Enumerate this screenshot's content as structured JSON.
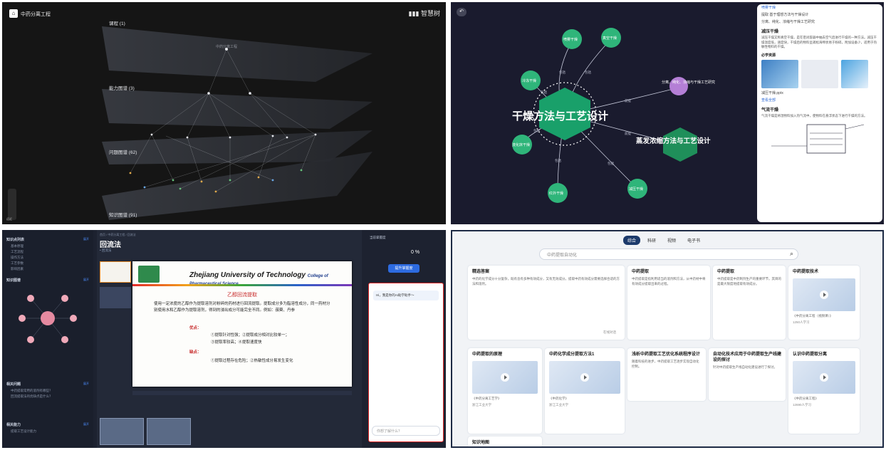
{
  "q1": {
    "title": "中药分离工程",
    "logo": "智慧树",
    "layers": [
      {
        "label": "课程 (1)"
      },
      {
        "label": "能力图谱 (3)"
      },
      {
        "label": "问题图谱 (62)"
      },
      {
        "label": "知识图谱 (91)"
      }
    ],
    "top_node": "中药分离工程",
    "zoom_label": "远近"
  },
  "q2": {
    "center": "干燥方法与工艺设计",
    "second": "蒸发浓缩方法与工艺设计",
    "nodes": [
      "喷雾干燥",
      "冷冻干燥",
      "真空干燥",
      "流化床干燥",
      "红外干燥",
      "减压干燥",
      "微波干燥"
    ],
    "purple_node": "分离、纯化、浓缩与干燥工艺研究",
    "edge_labels": [
      "包括",
      "包括",
      "包括",
      "包括",
      "包括",
      "包括",
      "包括",
      "前提",
      "前提"
    ],
    "side": {
      "top_item": "喷雾干燥",
      "rows": [
        "提取 基于理想方法与干燥设计",
        "分离、纯化、浓缩与干燥工艺研究"
      ],
      "h1": "减压干燥",
      "h1_text": "减压干燥又称真空干燥，是在密闭容器中抽去空气后进行干燥的一种方法。减压干燥温度低，速度快，干燥后的物料呈疏松海绵状易于粉碎，附加设备少，适用于热敏性物料的干燥。",
      "res_title": "必学资源",
      "res_file": "减压干燥.pptx",
      "link": "查看全部",
      "h2": "气流干燥",
      "h2_text": "气流干燥是将湿物料加入热气流中，使物料在悬浮状态下进行干燥的方法。"
    }
  },
  "q3": {
    "left_sections": [
      {
        "title": "知识点列表",
        "more": "展开",
        "items": [
          "基本原理",
          "工艺流程",
          "操作方法",
          "工艺参数",
          "影响因素"
        ]
      },
      {
        "title": "知识图谱",
        "more": "展开"
      },
      {
        "title": "相关问题",
        "more": "展开",
        "items": [
          "中药提取常用的溶剂有哪些？",
          "回流提取法的优缺点是什么？"
        ]
      },
      {
        "title": "相关能力",
        "more": "展开",
        "items": [
          "提取工艺设计能力"
        ]
      }
    ],
    "breadcrumb": "首页 / 中药分离工程 / 回流法",
    "title": "回流法",
    "subtitle": "• 回流法",
    "slide": {
      "school_en": "Zhejiang University of Technology",
      "college_en": "College of Pharmaceutical Science",
      "heading": "乙醇回流提取",
      "para": "使用一定浓度的乙醇作为提取溶剂对粉碎的药材进行回流提取。提取成分多为脂溶性成分，同一药材分别使用水和乙醇作为提取溶剂，得到的浸出成分可能完全不同。例如：菝葜、丹参",
      "pros_label": "优点：",
      "pros": [
        "①提取针对性强；②提取成分相对比较单一；",
        "③提取率较高；④提取速度快"
      ],
      "cons_label": "缺点：",
      "cons": [
        "①提取过程存在危险；②热敏性成分易发生变化"
      ]
    },
    "progress_label": "当前掌握度",
    "progress_value": "0 %",
    "mastery_button": "提升掌握度",
    "chat_greeting": "Hi，我是你的AI助学助手～",
    "chat_placeholder": "你想了解什么？"
  },
  "q4": {
    "tabs": [
      "综合",
      "科研",
      "视频",
      "电子书"
    ],
    "search_placeholder": "中药提取自动化",
    "cards": [
      {
        "title": "精选答案",
        "text": "中药的化学成分十分复杂，既有含有多种有效成分，又有无效成分。提取中药有效成分需要选择合适的方法和溶剂。",
        "meta": "在线对话"
      },
      {
        "title": "中药提取",
        "text": "中药提取是指利用适当的溶剂和方法，从中药材中将有效成分提取出来的过程。",
        "meta": ""
      },
      {
        "title": "中药提取",
        "text": "中药提取是中药制剂生产的重要环节，其目的是最大限度地提取有效成分。",
        "meta": ""
      },
      {
        "title": "中药提取技术",
        "text": "《中药分离工程（视频课）》",
        "meta": "1250人学习"
      },
      {
        "title": "中药提取的原理",
        "text": "《中药分离工艺学》",
        "meta": "浙江工业大学"
      },
      {
        "title": "中药化学成分提取方法1",
        "text": "《中药化学》",
        "meta": "浙江工业大学"
      },
      {
        "title": "浅析中药提取工艺优化系统程序设计",
        "text": "随着科技的进步，中药提取工艺逐步实现自动化控制。",
        "meta": ""
      },
      {
        "title": "自动化技术应用于中药提取生产线建设的探讨",
        "text": "针对中药提取生产线自动化建设进行了探讨。",
        "meta": ""
      },
      {
        "title": "认识中药提取分离",
        "text": "《中药分离工程》",
        "meta": "12690人学习"
      },
      {
        "title": "知识地图",
        "text": "",
        "meta": ""
      }
    ]
  },
  "colors": {
    "q2_node": "#2fb57a",
    "q2_center": "#19a06a",
    "q2_purple": "#b47fd6",
    "accent_blue": "#1c3a6b",
    "red": "#c72929"
  }
}
